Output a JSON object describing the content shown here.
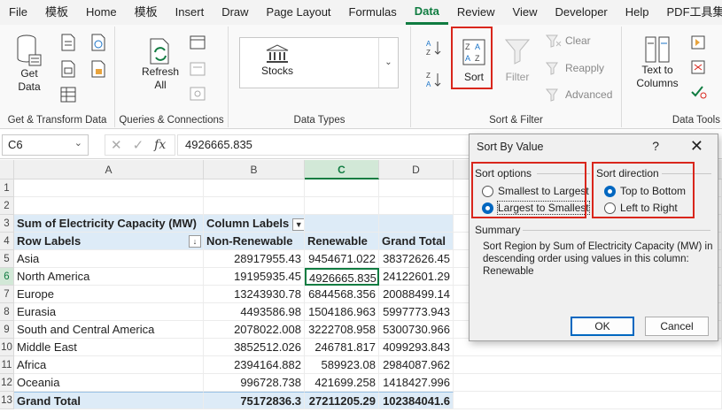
{
  "menu": [
    "File",
    "模板",
    "Home",
    "模板",
    "Insert",
    "Draw",
    "Page Layout",
    "Formulas",
    "Data",
    "Review",
    "View",
    "Developer",
    "Help",
    "PDF工具集"
  ],
  "ribbon": {
    "get_data": "Get\nData",
    "get_transform_label": "Get & Transform Data",
    "refresh_all": "Refresh\nAll",
    "queries_label": "Queries & Connections",
    "stocks": "Stocks",
    "data_types_label": "Data Types",
    "sort": "Sort",
    "filter": "Filter",
    "clear": "Clear",
    "reapply": "Reapply",
    "advanced": "Advanced",
    "sort_filter_label": "Sort & Filter",
    "text_to_columns": "Text to\nColumns",
    "data_tools_label": "Data Tools"
  },
  "formula_bar": {
    "name_box": "C6",
    "fx": "fx",
    "value": "4926665.835"
  },
  "columns": [
    "A",
    "B",
    "C",
    "D"
  ],
  "rows": [
    {
      "n": "1",
      "a": "",
      "b": "",
      "c": "",
      "d": ""
    },
    {
      "n": "2",
      "a": "",
      "b": "",
      "c": "",
      "d": ""
    },
    {
      "n": "3",
      "a": "Sum of Electricity Capacity (MW)",
      "b": "Column Labels",
      "c": "",
      "d": ""
    },
    {
      "n": "4",
      "a": "Row Labels",
      "b": "Non-Renewable",
      "c": "Renewable",
      "d": "Grand Total"
    },
    {
      "n": "5",
      "a": "Asia",
      "b": "28917955.43",
      "c": "9454671.022",
      "d": "38372626.45"
    },
    {
      "n": "6",
      "a": "North America",
      "b": "19195935.45",
      "c": "4926665.835",
      "d": "24122601.29"
    },
    {
      "n": "7",
      "a": "Europe",
      "b": "13243930.78",
      "c": "6844568.356",
      "d": "20088499.14"
    },
    {
      "n": "8",
      "a": "Eurasia",
      "b": "4493586.98",
      "c": "1504186.963",
      "d": "5997773.943"
    },
    {
      "n": "9",
      "a": "South and Central America",
      "b": "2078022.008",
      "c": "3222708.958",
      "d": "5300730.966"
    },
    {
      "n": "10",
      "a": "Middle East",
      "b": "3852512.026",
      "c": "246781.817",
      "d": "4099293.843"
    },
    {
      "n": "11",
      "a": "Africa",
      "b": "2394164.882",
      "c": "589923.08",
      "d": "2984087.962"
    },
    {
      "n": "12",
      "a": "Oceania",
      "b": "996728.738",
      "c": "421699.258",
      "d": "1418427.996"
    },
    {
      "n": "13",
      "a": "Grand Total",
      "b": "75172836.3",
      "c": "27211205.29",
      "d": "102384041.6"
    }
  ],
  "dialog": {
    "title": "Sort By Value",
    "help": "?",
    "close": "✕",
    "sort_options_label": "Sort options",
    "smallest_to_largest": "Smallest to Largest",
    "largest_to_smallest": "Largest to Smallest",
    "sort_direction_label": "Sort direction",
    "top_to_bottom": "Top to Bottom",
    "left_to_right": "Left to Right",
    "summary_label": "Summary",
    "summary_text": "Sort Region by Sum of Electricity Capacity (MW) in descending order using values in this column: Renewable",
    "ok": "OK",
    "cancel": "Cancel"
  },
  "colors": {
    "accent": "#107c41",
    "highlight": "#d9261c",
    "pivot_band": "#ddebf7",
    "radio_selected": "#0067c0"
  }
}
